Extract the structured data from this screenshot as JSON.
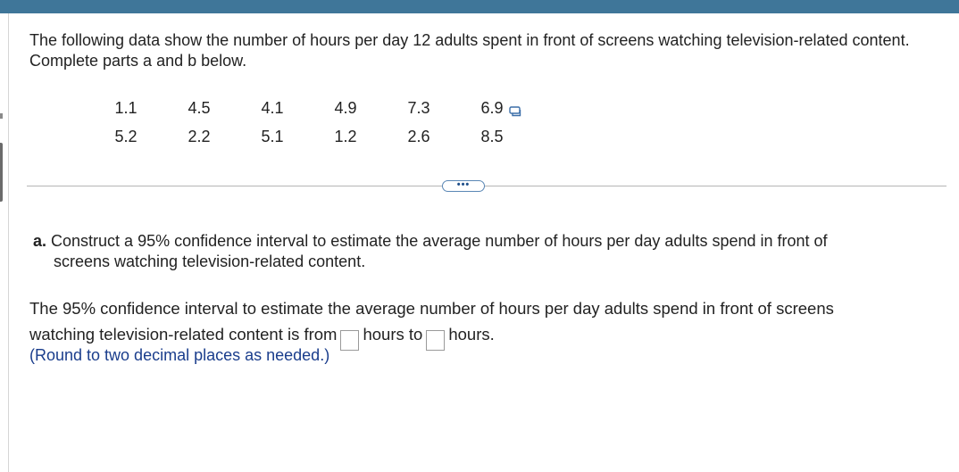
{
  "question": {
    "intro": "The following data show the number of hours per day 12 adults spent in front of screens watching television-related content. Complete parts a and b below."
  },
  "data_table": {
    "rows": [
      [
        "1.1",
        "4.5",
        "4.1",
        "4.9",
        "7.3",
        "6.9"
      ],
      [
        "5.2",
        "2.2",
        "5.1",
        "1.2",
        "2.6",
        "8.5"
      ]
    ],
    "copy_icon": "copy-data-icon"
  },
  "more_button": {
    "label": "•••"
  },
  "part_a": {
    "label": "a.",
    "text_line1": "Construct a 95% confidence interval to estimate the average number of hours per day adults spend in front of",
    "text_line2": "screens watching television-related content."
  },
  "answer": {
    "line1": "The 95% confidence interval to estimate the average number of hours per day adults spend in front of screens",
    "line2_start": "watching television-related content is from",
    "between": "hours to",
    "end": "hours.",
    "lower_value": "",
    "upper_value": ""
  },
  "hint": "(Round to two decimal places as needed.)",
  "colors": {
    "top_bar": "#3f7699",
    "hint_text": "#1a3d8c",
    "button_border": "#5a87b5"
  }
}
